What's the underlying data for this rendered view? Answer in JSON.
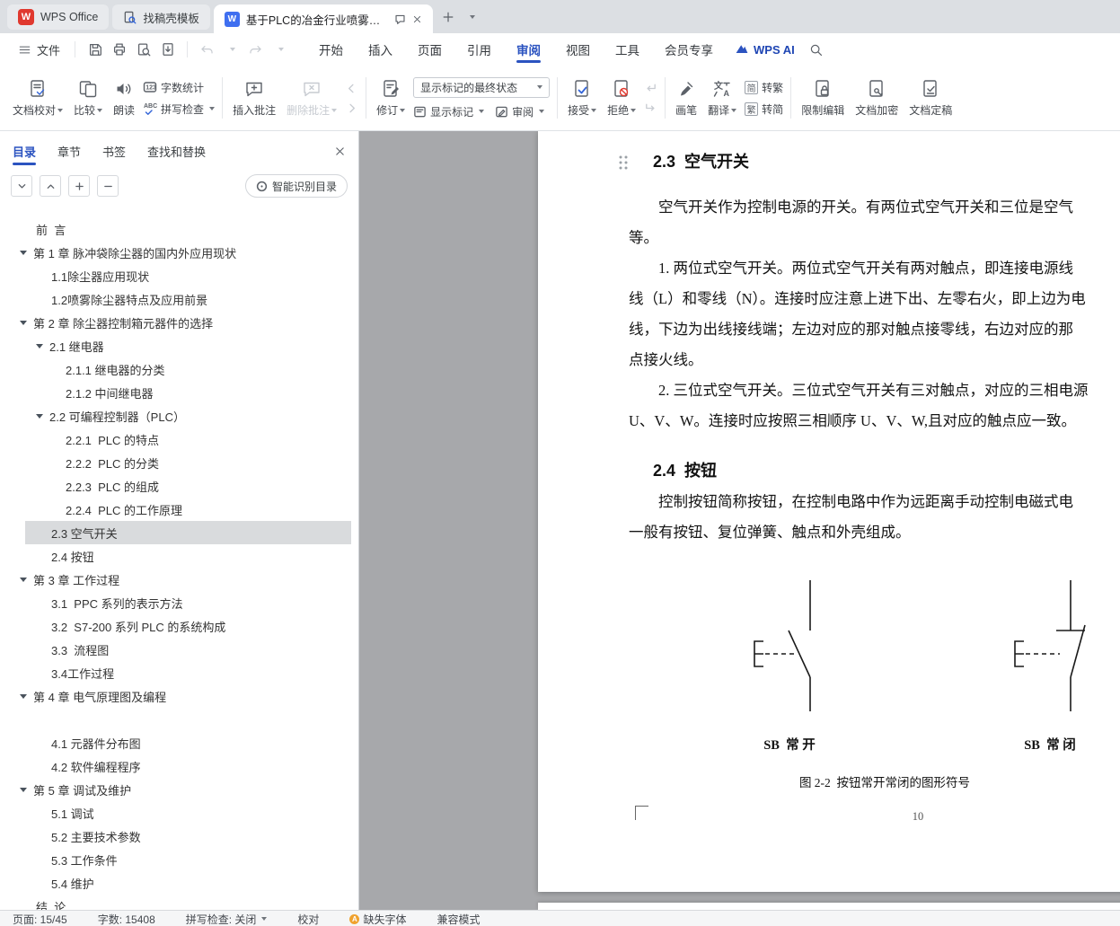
{
  "colors": {
    "accent": "#2b53c0",
    "wps_red": "#e0392f",
    "writer_blue": "#3f6ff0",
    "selected_row_bg": "#d9dbdd",
    "doc_background": "#a7a8ab",
    "warning": "#f0a22e"
  },
  "tabbar": {
    "home": "WPS Office",
    "template": "找稿壳模板",
    "doc": "基于PLC的冶金行业喷雾除尘技"
  },
  "menubar": {
    "file": "文件",
    "tabs": [
      {
        "label": "开始"
      },
      {
        "label": "插入"
      },
      {
        "label": "页面"
      },
      {
        "label": "引用"
      },
      {
        "label": "审阅"
      },
      {
        "label": "视图"
      },
      {
        "label": "工具"
      },
      {
        "label": "会员专享"
      }
    ],
    "ai": "WPS AI"
  },
  "ribbon": {
    "proofread": "文档校对",
    "compare": "比较",
    "read": "朗读",
    "wordcount": "字数统计",
    "spellcheck": "拼写检查",
    "insert_comment": "插入批注",
    "delete_comment": "删除批注",
    "revise": "修订",
    "markup_state": "显示标记的最终状态",
    "show_markup": "显示标记",
    "review": "审阅",
    "accept": "接受",
    "reject": "拒绝",
    "pen": "画笔",
    "translate": "翻译",
    "zh1_icon": "简",
    "zh1": "转繁",
    "zh2_icon": "繁",
    "zh2": "转简",
    "restrict": "限制编辑",
    "encrypt": "文档加密",
    "finalize": "文档定稿"
  },
  "sidebar": {
    "tabs": [
      {
        "label": "目录"
      },
      {
        "label": "章节"
      },
      {
        "label": "书签"
      },
      {
        "label": "查找和替换"
      }
    ],
    "smart": "智能识别目录",
    "toc": [
      {
        "label": "前  言"
      },
      {
        "label": "第 1 章 脉冲袋除尘器的国内外应用现状"
      },
      {
        "label": "1.1除尘器应用现状"
      },
      {
        "label": "1.2喷雾除尘器特点及应用前景"
      },
      {
        "label": "第 2 章 除尘器控制箱元器件的选择"
      },
      {
        "label": "2.1 继电器"
      },
      {
        "label": "2.1.1 继电器的分类"
      },
      {
        "label": "2.1.2 中间继电器"
      },
      {
        "label": "2.2 可编程控制器（PLC）"
      },
      {
        "label": "2.2.1  PLC 的特点"
      },
      {
        "label": "2.2.2  PLC 的分类"
      },
      {
        "label": "2.2.3  PLC 的组成"
      },
      {
        "label": "2.2.4  PLC 的工作原理"
      },
      {
        "label": "2.3 空气开关"
      },
      {
        "label": "2.4 按钮"
      },
      {
        "label": "第 3 章 工作过程"
      },
      {
        "label": "3.1  PPC 系列的表示方法"
      },
      {
        "label": "3.2  S7-200 系列 PLC 的系统构成"
      },
      {
        "label": "3.3  流程图"
      },
      {
        "label": "3.4工作过程"
      },
      {
        "label": "第 4 章 电气原理图及编程"
      },
      {
        "label": "4.1 元器件分布图"
      },
      {
        "label": "4.2 软件编程程序"
      },
      {
        "label": "第 5 章 调试及维护"
      },
      {
        "label": "5.1 调试"
      },
      {
        "label": "5.2 主要技术参数"
      },
      {
        "label": "5.3 工作条件"
      },
      {
        "label": "5.4 维护"
      },
      {
        "label": "结  论"
      }
    ]
  },
  "document": {
    "h23": "2.3  空气开关",
    "s23": [
      {
        "text": "空气开关作为控制电源的开关。有两位式空气开关和三位是空气"
      },
      {
        "text": "等。"
      },
      {
        "text": "1. 两位式空气开关。两位式空气开关有两对触点，即连接电源线"
      },
      {
        "text": "线（L）和零线（N）。连接时应注意上进下出、左零右火，即上边为电"
      },
      {
        "text": "线，下边为出线接线端；左边对应的那对触点接零线，右边对应的那"
      },
      {
        "text": "点接火线。"
      },
      {
        "text": "2. 三位式空气开关。三位式空气开关有三对触点，对应的三相电源"
      },
      {
        "text": "U、V、W。连接时应按照三相顺序 U、V、W,且对应的触点应一致。"
      }
    ],
    "h24": "2.4  按钮",
    "s24": [
      {
        "text": "控制按钮简称按钮，在控制电路中作为远距离手动控制电磁式电"
      },
      {
        "text": "一般有按钮、复位弹簧、触点和外壳组成。"
      }
    ],
    "fig": {
      "open": "SB  常 开",
      "closed": "SB  常 闭",
      "caption": "图 2-2  按钮常开常闭的图形符号",
      "page_no": "10"
    }
  },
  "statusbar": {
    "page": "页面: 15/45",
    "words": "字数: 15408",
    "spell": "拼写检查: 关闭",
    "proof": "校对",
    "missing": "缺失字体",
    "compat": "兼容模式"
  }
}
